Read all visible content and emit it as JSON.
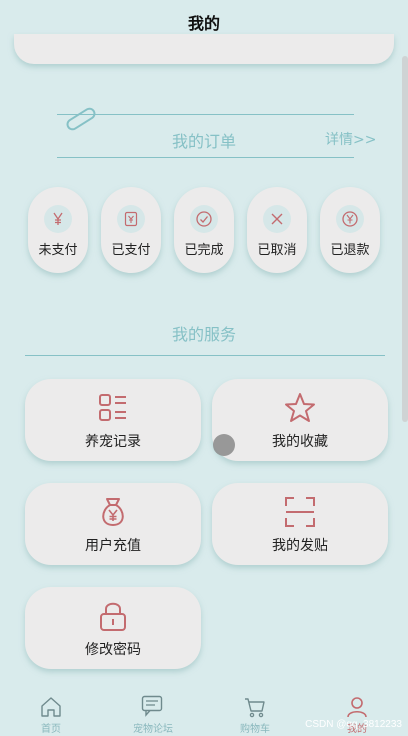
{
  "header": {
    "title": "我的"
  },
  "orders": {
    "title": "我的订单",
    "detail_label": "详情>>",
    "items": [
      {
        "label": "未支付",
        "icon": "yen-icon"
      },
      {
        "label": "已支付",
        "icon": "receipt-icon"
      },
      {
        "label": "已完成",
        "icon": "check-circle-icon"
      },
      {
        "label": "已取消",
        "icon": "close-icon"
      },
      {
        "label": "已退款",
        "icon": "yen-circle-icon"
      }
    ]
  },
  "services": {
    "title": "我的服务",
    "items": [
      {
        "label": "养宠记录",
        "icon": "list-icon"
      },
      {
        "label": "我的收藏",
        "icon": "star-icon"
      },
      {
        "label": "用户充值",
        "icon": "money-bag-icon"
      },
      {
        "label": "我的发贴",
        "icon": "scan-icon"
      },
      {
        "label": "修改密码",
        "icon": "lock-icon"
      }
    ]
  },
  "tabbar": {
    "items": [
      {
        "label": "首页",
        "icon": "home-icon",
        "active": false
      },
      {
        "label": "宠物论坛",
        "icon": "chat-icon",
        "active": false
      },
      {
        "label": "购物车",
        "icon": "cart-icon",
        "active": false
      },
      {
        "label": "我的",
        "icon": "user-icon",
        "active": true
      }
    ]
  },
  "colors": {
    "accent": "#86c1c6",
    "icon": "#c36b6f",
    "background": "#d9ebec",
    "card": "#ecebeb"
  },
  "watermark": "CSDN @qq_3812233"
}
